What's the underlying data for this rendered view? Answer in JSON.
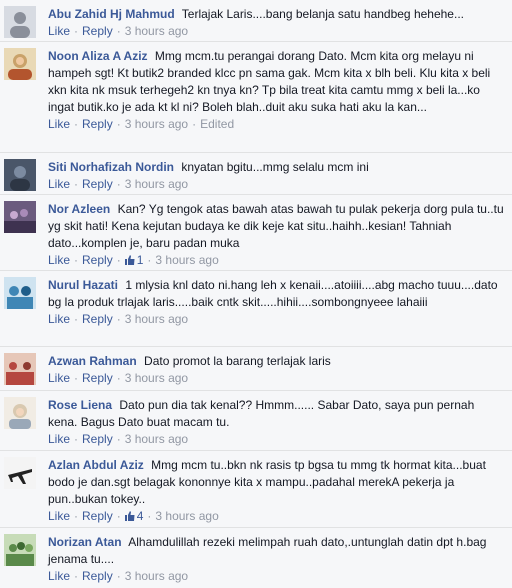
{
  "comments": [
    {
      "author": "Abu Zahid Hj Mahmud",
      "text": "Terlajak Laris....bang belanja satu handbeg hehehe...",
      "like_label": "Like",
      "reply_label": "Reply",
      "time": "3 hours ago",
      "avatar_color": "#8a8f9a"
    },
    {
      "author": "Noon Aliza A Aziz",
      "text": "Mmg mcm.tu perangai dorang Dato. Mcm kita org melayu ni hampeh sgt! Kt butik2 branded klcc pn sama gak. Mcm kita x blh beli. Klu kita x beli xkn kita nk msuk terhegeh2 kn tnya kn? Tp bila treat kita camtu mmg x beli la...ko ingat butik.ko je ada kt kl ni? Boleh blah..duit aku suka hati aku la kan...",
      "like_label": "Like",
      "reply_label": "Reply",
      "time": "3 hours ago",
      "edited": "Edited",
      "avatar_color": "#c9a26a"
    },
    {
      "author": "Siti Norhafizah Nordin",
      "text": "knyatan bgitu...mmg selalu mcm ini",
      "like_label": "Like",
      "reply_label": "Reply",
      "time": "3 hours ago",
      "avatar_color": "#5d6f86"
    },
    {
      "author": "Nor Azleen",
      "text": "Kan? Yg tengok atas bawah atas bawah tu pulak pekerja dorg pula tu..tu yg skit hati! Kena kejutan budaya ke dik keje kat situ..haihh..kesian! Tahniah dato...komplen je, baru padan muka",
      "like_label": "Like",
      "reply_label": "Reply",
      "like_count": "1",
      "time": "3 hours ago",
      "avatar_color": "#7b6a8e"
    },
    {
      "author": "Nurul Hazati",
      "text": "1 mlysia knl dato ni.hang leh x kenaii....atoiiii....abg macho tuuu....dato bg la produk trlajak laris.....baik cntk skit.....hihii....sombongnyeee lahaiii",
      "like_label": "Like",
      "reply_label": "Reply",
      "time": "3 hours ago",
      "avatar_color": "#3f86b5"
    },
    {
      "author": "Azwan Rahman",
      "text": "Dato promot la barang terlajak laris",
      "like_label": "Like",
      "reply_label": "Reply",
      "time": "3 hours ago",
      "avatar_color": "#b5473f"
    },
    {
      "author": "Rose Liena",
      "text": "Dato pun dia tak kenal?? Hmmm...... Sabar Dato, saya pun pernah kena. Bagus Dato buat macam tu.",
      "like_label": "Like",
      "reply_label": "Reply",
      "time": "3 hours ago",
      "avatar_color": "#d9c9b0"
    },
    {
      "author": "Azlan Abdul Aziz",
      "text": "Mmg mcm tu..bkn nk rasis tp bgsa tu mmg tk hormat kita...buat bodo je dan.sgt belagak kononnye kita x mampu..padahal merekA pekerja ja pun..bukan tokey..",
      "like_label": "Like",
      "reply_label": "Reply",
      "like_count": "4",
      "time": "3 hours ago",
      "avatar_color": "#e8e8e8"
    },
    {
      "author": "Norizan Atan",
      "text": "Alhamdulillah rezeki melimpah ruah dato,.untunglah datin dpt h.bag jenama tu....",
      "like_label": "Like",
      "reply_label": "Reply",
      "time": "3 hours ago",
      "avatar_color": "#5a8a4a"
    }
  ],
  "colors": {
    "link": "#3b5998",
    "meta": "#9197a3",
    "background": "#f6f7f9",
    "divider": "#e1e2e3"
  },
  "icons": {
    "like_count": "thumbs-up-icon"
  }
}
